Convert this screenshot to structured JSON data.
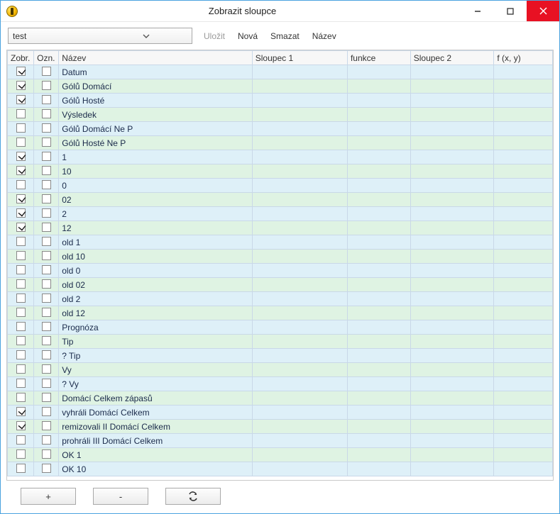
{
  "window": {
    "title": "Zobrazit sloupce"
  },
  "toolbar": {
    "combo_value": "test",
    "save_label": "Uložit",
    "new_label": "Nová",
    "delete_label": "Smazat",
    "name_label": "Název"
  },
  "columns": {
    "zobr": "Zobr.",
    "ozn": "Ozn.",
    "nazev": "Název",
    "sloupec1": "Sloupec 1",
    "funkce": "funkce",
    "sloupec2": "Sloupec 2",
    "fxy": "f (x, y)"
  },
  "rows": [
    {
      "zobr": true,
      "ozn": false,
      "nazev": "Datum"
    },
    {
      "zobr": true,
      "ozn": false,
      "nazev": "Gólů Domácí"
    },
    {
      "zobr": true,
      "ozn": false,
      "nazev": "Gólů Hosté"
    },
    {
      "zobr": false,
      "ozn": false,
      "nazev": "Výsledek"
    },
    {
      "zobr": false,
      "ozn": false,
      "nazev": "Gólů Domácí Ne P"
    },
    {
      "zobr": false,
      "ozn": false,
      "nazev": "Gólů Hosté Ne P"
    },
    {
      "zobr": true,
      "ozn": false,
      "nazev": "1"
    },
    {
      "zobr": true,
      "ozn": false,
      "nazev": "10"
    },
    {
      "zobr": false,
      "ozn": false,
      "nazev": "0"
    },
    {
      "zobr": true,
      "ozn": false,
      "nazev": "02"
    },
    {
      "zobr": true,
      "ozn": false,
      "nazev": "2"
    },
    {
      "zobr": true,
      "ozn": false,
      "nazev": "12"
    },
    {
      "zobr": false,
      "ozn": false,
      "nazev": "old 1"
    },
    {
      "zobr": false,
      "ozn": false,
      "nazev": "old 10"
    },
    {
      "zobr": false,
      "ozn": false,
      "nazev": "old 0"
    },
    {
      "zobr": false,
      "ozn": false,
      "nazev": "old 02"
    },
    {
      "zobr": false,
      "ozn": false,
      "nazev": "old 2"
    },
    {
      "zobr": false,
      "ozn": false,
      "nazev": "old 12"
    },
    {
      "zobr": false,
      "ozn": false,
      "nazev": "Prognóza"
    },
    {
      "zobr": false,
      "ozn": false,
      "nazev": "Tip"
    },
    {
      "zobr": false,
      "ozn": false,
      "nazev": "? Tip"
    },
    {
      "zobr": false,
      "ozn": false,
      "nazev": "Vy"
    },
    {
      "zobr": false,
      "ozn": false,
      "nazev": "? Vy"
    },
    {
      "zobr": false,
      "ozn": false,
      "nazev": "Domácí Celkem zápasů"
    },
    {
      "zobr": true,
      "ozn": false,
      "nazev": "vyhráli Domácí Celkem"
    },
    {
      "zobr": true,
      "ozn": false,
      "nazev": "remizovali II Domácí Celkem"
    },
    {
      "zobr": false,
      "ozn": false,
      "nazev": "prohráli III Domácí Celkem"
    },
    {
      "zobr": false,
      "ozn": false,
      "nazev": "OK 1"
    },
    {
      "zobr": false,
      "ozn": false,
      "nazev": "OK 10"
    }
  ],
  "footer": {
    "plus_label": "+",
    "minus_label": "-"
  }
}
